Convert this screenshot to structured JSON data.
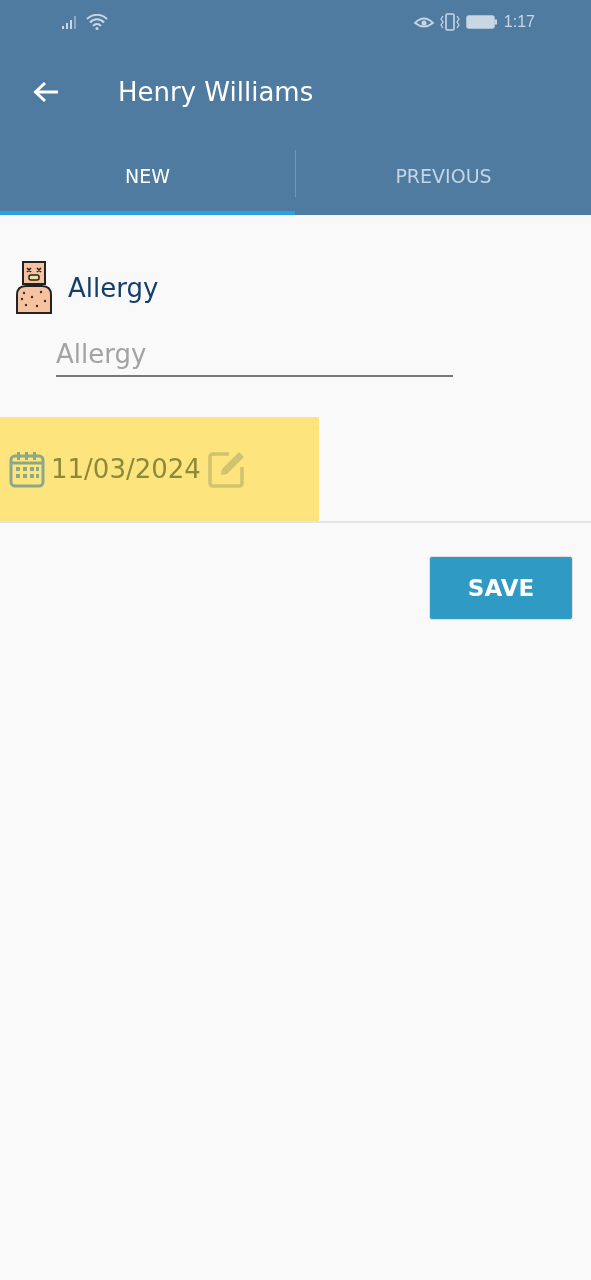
{
  "status_bar": {
    "time": "1:17"
  },
  "app_bar": {
    "title": "Henry Williams"
  },
  "tabs": [
    {
      "label": "NEW",
      "selected": true
    },
    {
      "label": "PREVIOUS",
      "selected": false
    }
  ],
  "section": {
    "title": "Allergy"
  },
  "allergy_field": {
    "placeholder": "Allergy"
  },
  "date_field": {
    "value": "11/03/2024",
    "highlighted": true
  },
  "buttons": [
    {
      "label": "SAVE"
    }
  ]
}
